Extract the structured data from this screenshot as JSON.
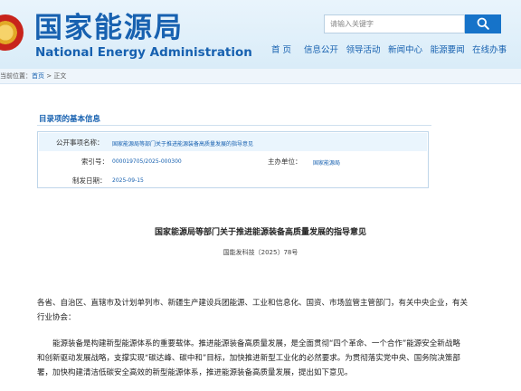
{
  "header": {
    "logo_cn": "国家能源局",
    "logo_en": "National Energy Administration",
    "search_placeholder": "请输入关键字",
    "nav": [
      "首 页",
      "信息公开",
      "领导活动",
      "新闻中心",
      "能源要闻",
      "在线办事"
    ]
  },
  "breadcrumb": {
    "prefix": "当前位置：",
    "home": "首页",
    "sep": " > ",
    "current": "正文"
  },
  "meta": {
    "section_title": "目录项的基本信息",
    "title_label": "公开事项名称：",
    "title_value": "国家能源局等部门关于推进能源装备高质量发展的指导意见",
    "index_label": "索引号：",
    "index_value": "000019705/2025-000300",
    "org_label": "主办单位：",
    "org_value": "国家能源局",
    "date_label": "制发日期：",
    "date_value": "2025-09-15"
  },
  "document": {
    "title": "国家能源局等部门关于推进能源装备高质量发展的指导意见",
    "number": "国能发科技〔2025〕78号",
    "para1_line1": "各省、自治区、直辖市及计划单列市、新疆生产建设兵团能源、工业和信息化、国资、市场监管主管部门，有关中央企业，有关",
    "para1_line2": "行业协会：",
    "para2_line1": "能源装备是构建新型能源体系的重要载体。推进能源装备高质量发展，是全面贯彻“四个革命、一个合作”能源安全新战略",
    "para2_line2": "和创新驱动发展战略，支撑实现“碳达峰、碳中和”目标，加快推进新型工业化的必然要求。为贯彻落实党中央、国务院决策部",
    "para2_line3": "署，加快构建清洁低碳安全高效的新型能源体系，推进能源装备高质量发展，提出如下意见。"
  },
  "colors": {
    "brand_blue": "#1761b0",
    "search_button": "#1673c9",
    "header_bg": "#e9f4fc"
  }
}
